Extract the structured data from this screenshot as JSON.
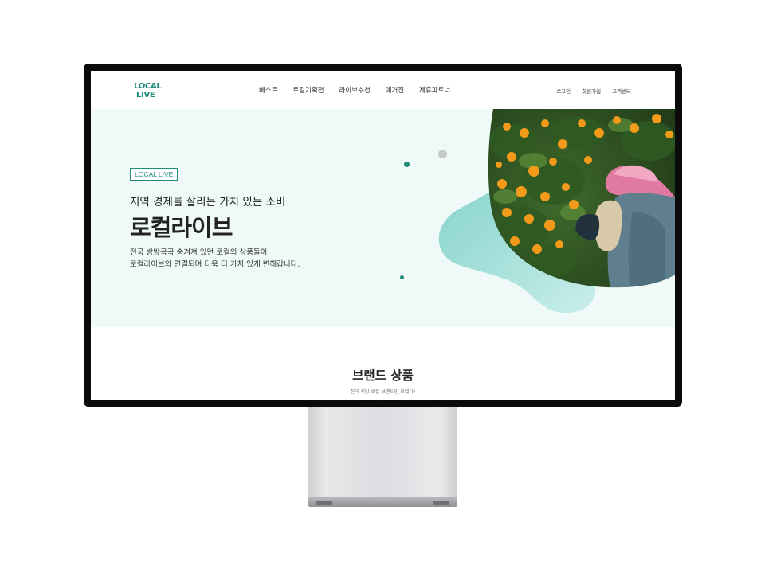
{
  "header": {
    "logo": [
      "LOCAL",
      "LIVE"
    ],
    "nav": [
      "베스트",
      "로컬기획전",
      "라이브추천",
      "매거진",
      "제휴파트너"
    ],
    "util": [
      "로그인",
      "회원가입",
      "고객센터"
    ]
  },
  "hero": {
    "badge": "LOCAL LIVE",
    "subhead": "지역 경제를 살리는 가치 있는 소비",
    "headline": "로컬라이브",
    "desc": [
      "전국 방방곡곡 숨겨져 있던 로컬의 상품들이",
      "로컬라이브와 연결되며 더욱 더 가치 있게 변해갑니다."
    ]
  },
  "brand": {
    "title": "브랜드 상품",
    "subtitle": "전국 지방 로컬 브랜드만 모였다!"
  },
  "colors": {
    "accent": "#1f8a78",
    "hero_bg": "#eff9f8",
    "blob": "#9fdcd6"
  },
  "icons": [
    "monitor-stand",
    "orange-harvest-photo"
  ]
}
